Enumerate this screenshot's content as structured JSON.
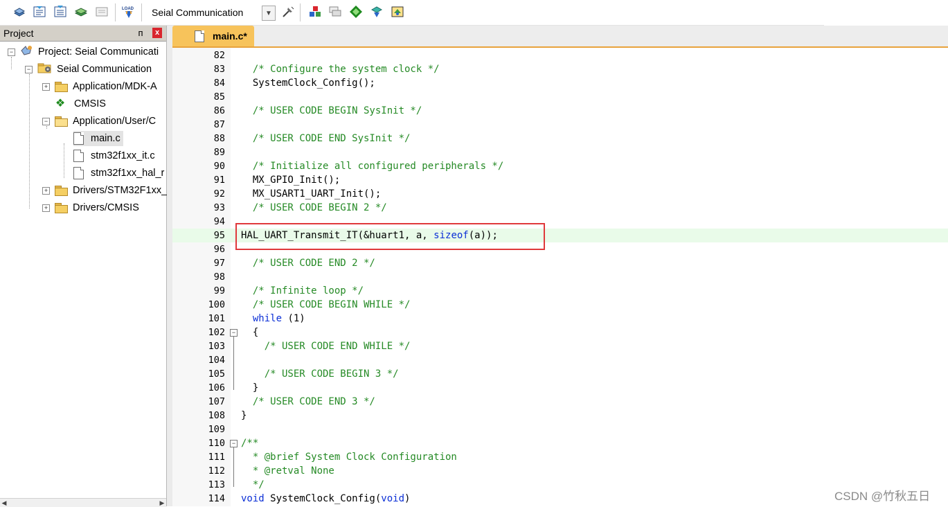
{
  "toolbar": {
    "target_name": "Seial Communication",
    "buttons": [
      "project-icon",
      "translate-icon",
      "build-icon",
      "rebuild-icon",
      "batch-build-icon",
      "download-load-icon",
      "target-options-icon",
      "manage-components-icon",
      "file-extensions-icon",
      "run-time-env-icon",
      "select-packs-icon",
      "pack-installer-icon"
    ],
    "load_label": "LOAD"
  },
  "project_panel": {
    "title": "Project",
    "pin": "ᴨ",
    "close": "x",
    "tree": {
      "root": "Project: Seial Communicati",
      "target": "Seial Communication",
      "groups": [
        {
          "label": "Application/MDK-A",
          "expanded": false
        },
        {
          "label": "CMSIS",
          "type": "component"
        },
        {
          "label": "Application/User/C",
          "expanded": true,
          "files": [
            "main.c",
            "stm32f1xx_it.c",
            "stm32f1xx_hal_r"
          ]
        },
        {
          "label": "Drivers/STM32F1xx_",
          "expanded": false
        },
        {
          "label": "Drivers/CMSIS",
          "expanded": false
        }
      ]
    }
  },
  "editor": {
    "active_tab": "main.c*",
    "lines": [
      {
        "n": "82",
        "text": ""
      },
      {
        "n": "83",
        "text": "  /* Configure the system clock */",
        "kind": "comment"
      },
      {
        "n": "84",
        "text": "  SystemClock_Config();"
      },
      {
        "n": "85",
        "text": ""
      },
      {
        "n": "86",
        "text": "  /* USER CODE BEGIN SysInit */",
        "kind": "comment"
      },
      {
        "n": "87",
        "text": ""
      },
      {
        "n": "88",
        "text": "  /* USER CODE END SysInit */",
        "kind": "comment"
      },
      {
        "n": "89",
        "text": ""
      },
      {
        "n": "90",
        "text": "  /* Initialize all configured peripherals */",
        "kind": "comment"
      },
      {
        "n": "91",
        "text": "  MX_GPIO_Init();"
      },
      {
        "n": "92",
        "text": "  MX_USART1_UART_Init();"
      },
      {
        "n": "93",
        "text": "  /* USER CODE BEGIN 2 */",
        "kind": "comment"
      },
      {
        "n": "94",
        "text": ""
      },
      {
        "n": "95",
        "text_a": "HAL_UART_Transmit_IT(&huart1, a, ",
        "kw": "sizeof",
        "text_b": "(a));",
        "kind": "highlight"
      },
      {
        "n": "96",
        "text": ""
      },
      {
        "n": "97",
        "text": "  /* USER CODE END 2 */",
        "kind": "comment"
      },
      {
        "n": "98",
        "text": ""
      },
      {
        "n": "99",
        "text": "  /* Infinite loop */",
        "kind": "comment"
      },
      {
        "n": "100",
        "text": "  /* USER CODE BEGIN WHILE */",
        "kind": "comment"
      },
      {
        "n": "101",
        "kw": "while",
        "text_b": " (1)",
        "kind": "keyword-line"
      },
      {
        "n": "102",
        "text": "  {",
        "fold": "open"
      },
      {
        "n": "103",
        "text": "    /* USER CODE END WHILE */",
        "kind": "comment"
      },
      {
        "n": "104",
        "text": ""
      },
      {
        "n": "105",
        "text": "    /* USER CODE BEGIN 3 */",
        "kind": "comment"
      },
      {
        "n": "106",
        "text": "  }"
      },
      {
        "n": "107",
        "text": "  /* USER CODE END 3 */",
        "kind": "comment"
      },
      {
        "n": "108",
        "text": "}"
      },
      {
        "n": "109",
        "text": ""
      },
      {
        "n": "110",
        "text": "/**",
        "kind": "comment",
        "fold": "open"
      },
      {
        "n": "111",
        "text": "  * @brief System Clock Configuration",
        "kind": "comment"
      },
      {
        "n": "112",
        "text": "  * @retval None",
        "kind": "comment"
      },
      {
        "n": "113",
        "text": "  */",
        "kind": "comment"
      },
      {
        "n": "114",
        "kw": "void",
        "text_b": " SystemClock_Config(",
        "kw2": "void",
        "text_c": ")",
        "kind": "void-line"
      }
    ]
  },
  "colors": {
    "comment": "#258a25",
    "keyword": "#0b2fd6",
    "highlight_border": "#e0383b",
    "active_tab": "#f7c35b"
  },
  "watermark": "CSDN @竹秋五日"
}
